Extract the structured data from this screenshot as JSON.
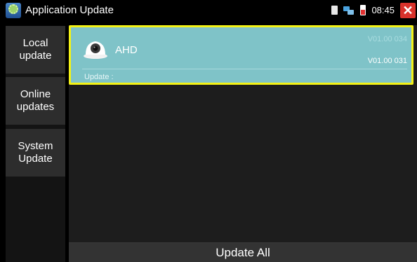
{
  "statusbar": {
    "app_icon": "upgrade-gear-icon",
    "title": "Application Update",
    "icons": [
      "sd-card-icon",
      "network-icon",
      "battery-icon"
    ],
    "time": "08:45",
    "close_icon": "close-icon",
    "close_label": "✕"
  },
  "sidebar": {
    "items": [
      {
        "label": "Local\nupdate"
      },
      {
        "label": "Online\nupdates"
      },
      {
        "label": "System\nUpdate"
      }
    ]
  },
  "main": {
    "card": {
      "icon": "dome-camera-icon",
      "name": "AHD",
      "latest_version": "V01.00 034",
      "current_version": "V01.00 031",
      "update_label": "Update :"
    }
  },
  "footer": {
    "update_all_label": "Update All"
  },
  "colors": {
    "card_background": "#7fc3c8",
    "card_highlight_border": "#f4f216",
    "close_button": "#d9322b",
    "sidebar_item": "#2d2d2d"
  }
}
